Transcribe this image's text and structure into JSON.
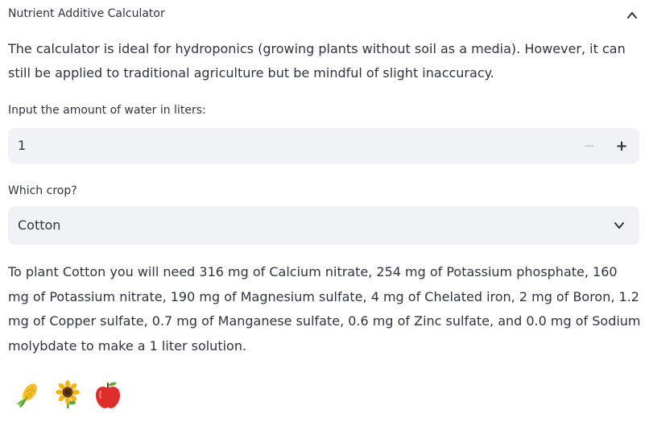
{
  "expander": {
    "title": "Nutrient Additive Calculator",
    "icon": "chevron-up-icon"
  },
  "intro_text": "The calculator is ideal for hydroponics (growing plants without soil as a media). However, it can still be applied to traditional agriculture but be mindful of slight inaccuracy.",
  "water_input": {
    "label": "Input the amount of water in liters:",
    "value": "1",
    "minus_label": "−",
    "plus_label": "+"
  },
  "crop_select": {
    "label": "Which crop?",
    "selected": "Cotton",
    "icon": "chevron-down-icon"
  },
  "result_text": "To plant Cotton you will need 316 mg of Calcium nitrate, 254 mg of Potassium phosphate, 160 mg of Potassium nitrate, 190 mg of Magnesium sulfate, 4 mg of Chelated iron, 2 mg of Boron, 1.2 mg of Copper sulfate, 0.7 mg of Manganese sulfate, 0.6 mg of Zinc sulfate, and 0.0 mg of Sodium molybdate to make a 1 liter solution.",
  "emojis": [
    "corn-icon",
    "sunflower-icon",
    "apple-icon"
  ],
  "colors": {
    "text": "#31333f",
    "input_bg": "#f0f2f6",
    "disabled": "#c4c6cc"
  }
}
